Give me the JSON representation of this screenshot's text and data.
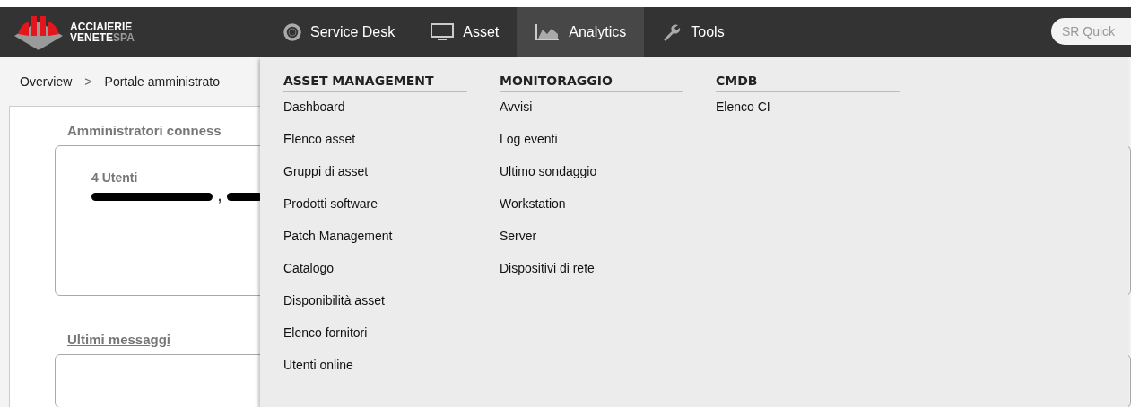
{
  "header": {
    "logo": {
      "line_1": "ACCIAIERIE",
      "line_2a": "VENETE",
      "line_2b": "SPA"
    },
    "nav": [
      {
        "label": "Service Desk",
        "kind": "lifebuoy",
        "selected": false
      },
      {
        "label": "Asset",
        "kind": "monitor",
        "selected": false
      },
      {
        "label": "Analytics",
        "kind": "chart",
        "selected": true
      },
      {
        "label": "Tools",
        "kind": "wrench",
        "selected": false
      }
    ],
    "search": {
      "placeholder": "SR Quick"
    }
  },
  "breadcrumb": [
    "Overview",
    "Portale amministrato"
  ],
  "breadcrumb_separator": ">",
  "sections": [
    {
      "title": "Amministratori conness",
      "underlined": false,
      "count": "4 Utenti",
      "separator": ","
    },
    {
      "title": "Ultimi messaggi",
      "underlined": true
    }
  ],
  "menu": {
    "columns": [
      {
        "heading": "ASSET MANAGEMENT",
        "items": [
          "Dashboard",
          "Elenco asset",
          "Gruppi di asset",
          "Prodotti software",
          "Patch Management",
          "Catalogo",
          "Disponibilità asset",
          "Elenco fornitori",
          "Utenti online"
        ]
      },
      {
        "heading": "MONITORAGGIO",
        "items": [
          "Avvisi",
          "Log eventi",
          "Ultimo sondaggio",
          "Workstation",
          "Server",
          "Dispositivi di rete"
        ]
      },
      {
        "heading": "CMDB",
        "items": [
          "Elenco CI"
        ]
      }
    ]
  }
}
